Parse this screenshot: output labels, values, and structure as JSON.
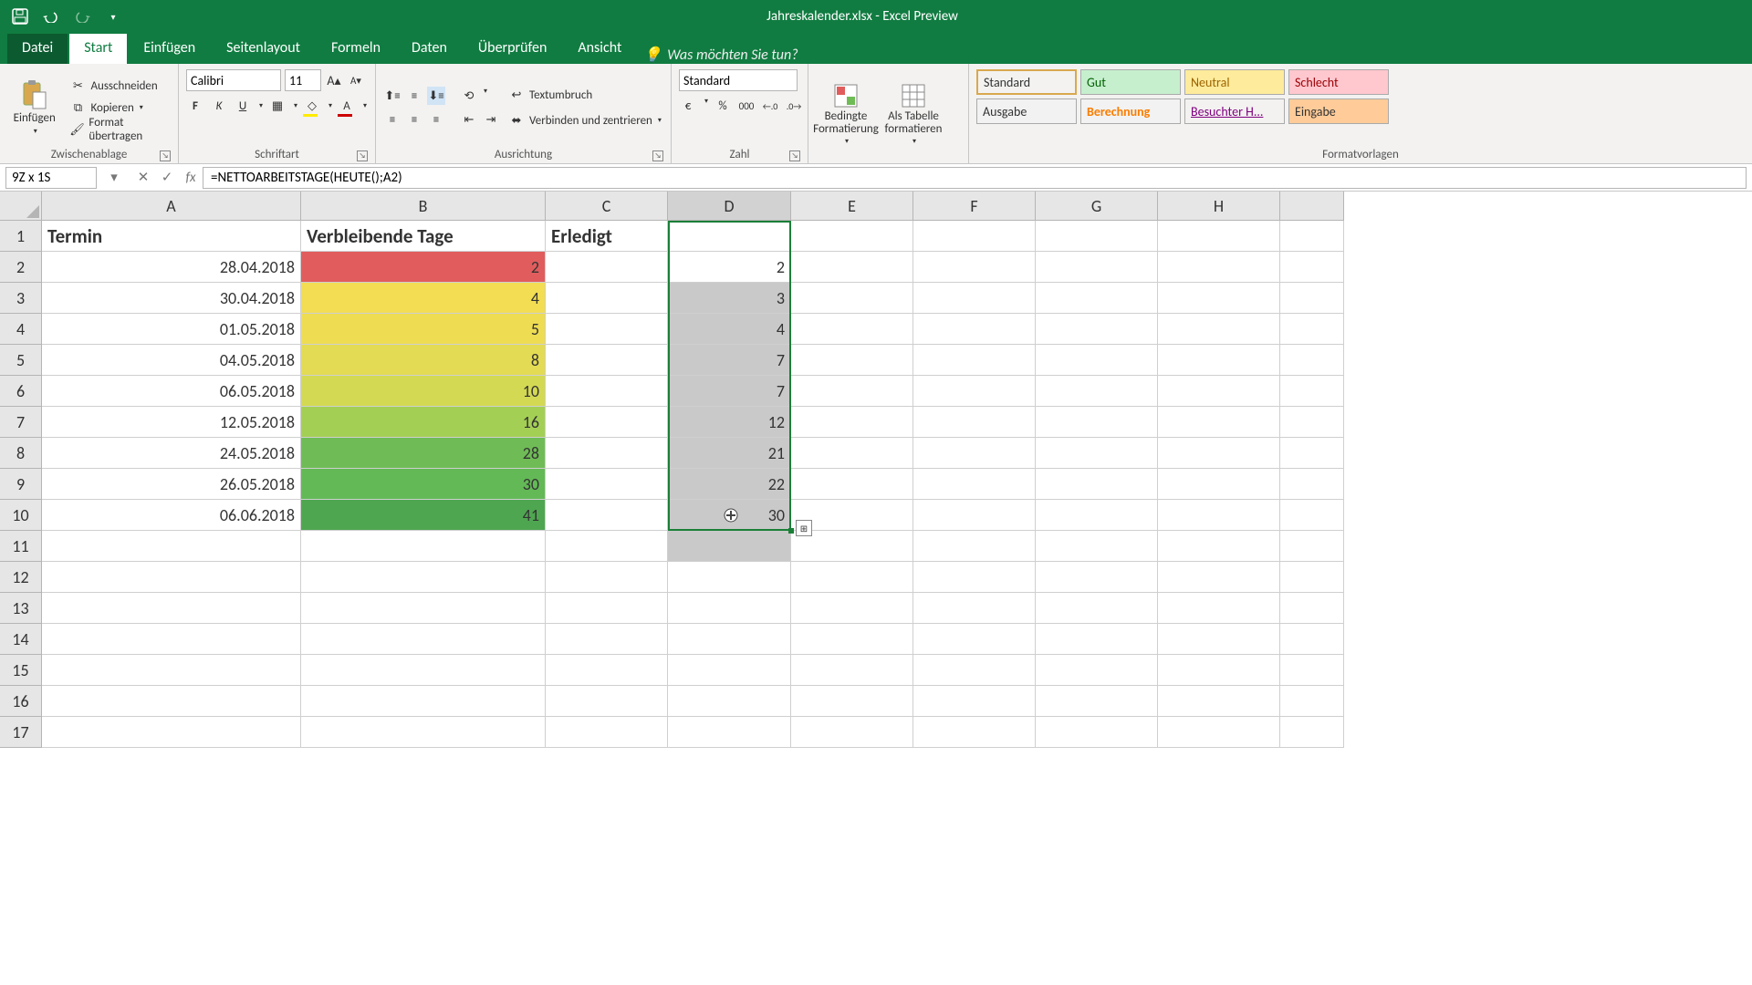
{
  "app": {
    "title": "Jahreskalender.xlsx  -  Excel Preview"
  },
  "tabs": {
    "file": "Datei",
    "home": "Start",
    "insert": "Einfügen",
    "pagelayout": "Seitenlayout",
    "formulas": "Formeln",
    "data": "Daten",
    "review": "Überprüfen",
    "view": "Ansicht",
    "tellme": "Was möchten Sie tun?"
  },
  "ribbon": {
    "paste": "Einfügen",
    "cut": "Ausschneiden",
    "copy": "Kopieren",
    "fmtpainter": "Format übertragen",
    "clipboard_grp": "Zwischenablage",
    "font_name": "Calibri",
    "font_size": "11",
    "font_grp": "Schriftart",
    "wrap": "Textumbruch",
    "merge": "Verbinden und zentrieren",
    "align_grp": "Ausrichtung",
    "numfmt": "Standard",
    "num_grp": "Zahl",
    "cond": "Bedingte Formatierung",
    "table": "Als Tabelle formatieren",
    "style_normal": "Standard",
    "style_good": "Gut",
    "style_neutral": "Neutral",
    "style_bad": "Schlecht",
    "style_output": "Ausgabe",
    "style_calc": "Berechnung",
    "style_visited": "Besuchter H...",
    "style_input": "Eingabe",
    "styles_grp": "Formatvorlagen"
  },
  "fx": {
    "namebox": "9Z x 1S",
    "formula": "=NETTOARBEITSTAGE(HEUTE();A2)"
  },
  "cols": [
    "A",
    "B",
    "C",
    "D",
    "E",
    "F",
    "G",
    "H"
  ],
  "header_row": {
    "A": "Termin",
    "B": "Verbleibende Tage",
    "C": "Erledigt"
  },
  "rows": [
    {
      "n": 2,
      "A": "28.04.2018",
      "B": "2",
      "D": "2",
      "bg": "#e15d5d"
    },
    {
      "n": 3,
      "A": "30.04.2018",
      "B": "4",
      "D": "3",
      "bg": "#f2dd53"
    },
    {
      "n": 4,
      "A": "01.05.2018",
      "B": "5",
      "D": "4",
      "bg": "#eedc53"
    },
    {
      "n": 5,
      "A": "04.05.2018",
      "B": "8",
      "D": "7",
      "bg": "#e3db53"
    },
    {
      "n": 6,
      "A": "06.05.2018",
      "B": "10",
      "D": "7",
      "bg": "#d3d953"
    },
    {
      "n": 7,
      "A": "12.05.2018",
      "B": "16",
      "D": "12",
      "bg": "#a4cf55"
    },
    {
      "n": 8,
      "A": "24.05.2018",
      "B": "28",
      "D": "21",
      "bg": "#6fbc56"
    },
    {
      "n": 9,
      "A": "26.05.2018",
      "B": "30",
      "D": "22",
      "bg": "#63b956"
    },
    {
      "n": 10,
      "A": "06.06.2018",
      "B": "41",
      "D": "30",
      "bg": "#4fa651"
    }
  ],
  "chart_data": {
    "type": "table",
    "title": "Verbleibende Tage bis Termin (mit bedingter Formatierung Farbskala)",
    "columns": [
      "Termin",
      "Verbleibende Tage",
      "Erledigt",
      "D"
    ],
    "data": [
      [
        "28.04.2018",
        2,
        null,
        2
      ],
      [
        "30.04.2018",
        4,
        null,
        3
      ],
      [
        "01.05.2018",
        5,
        null,
        4
      ],
      [
        "04.05.2018",
        8,
        null,
        7
      ],
      [
        "06.05.2018",
        10,
        null,
        7
      ],
      [
        "12.05.2018",
        16,
        null,
        12
      ],
      [
        "24.05.2018",
        28,
        null,
        21
      ],
      [
        "26.05.2018",
        30,
        null,
        22
      ],
      [
        "06.06.2018",
        41,
        null,
        30
      ]
    ],
    "color_scale_column": "Verbleibende Tage",
    "color_scale": {
      "min_color": "#e15d5d",
      "mid_color": "#f2dd53",
      "max_color": "#4fa651"
    }
  }
}
